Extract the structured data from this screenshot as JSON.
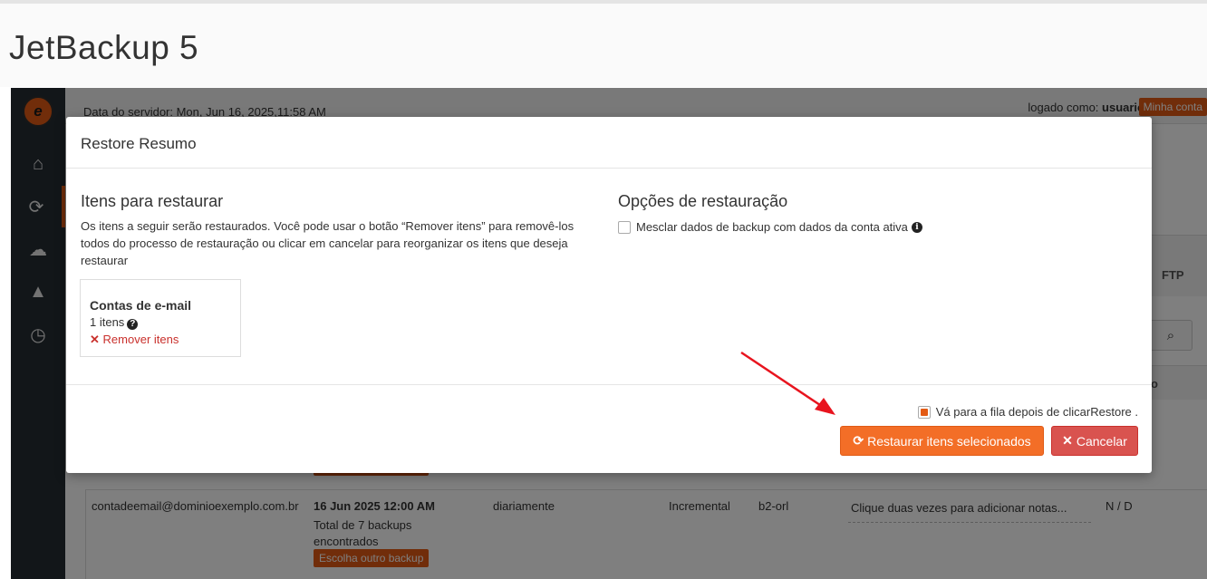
{
  "app": {
    "title": "JetBackup 5"
  },
  "header": {
    "server_date": "Data do servidor: Mon, Jun 16, 2025,11:58 AM",
    "logged_as_prefix": "logado como: ",
    "username": "usuario",
    "separator": " |",
    "my_account": "Minha conta"
  },
  "sidebar": {
    "items": [
      {
        "name": "home-icon",
        "glyph": "⌂"
      },
      {
        "name": "restore-icon",
        "glyph": "⟳"
      },
      {
        "name": "cloud-download-icon",
        "glyph": "☁"
      },
      {
        "name": "warning-icon",
        "glyph": "▲"
      },
      {
        "name": "clock-icon",
        "glyph": "◷"
      }
    ]
  },
  "background": {
    "ftp_header": "FTP",
    "col_header": "o",
    "row": {
      "email": "contadeemail@dominioexemplo.com.br",
      "date": "16 Jun 2025 12:00 AM",
      "total": "Total de 7 backups encontrados",
      "choose_other": "Escolha outro backup",
      "frequency": "diariamente",
      "type": "Incremental",
      "destination": "b2-orl",
      "notes": "Clique duas vezes para adicionar notas...",
      "nd": "N / D"
    }
  },
  "modal": {
    "title": "Restore Resumo",
    "items_title": "Itens para restaurar",
    "items_desc": "Os itens a seguir serão restaurados. Você pode usar o botão “Remover itens” para removê-los todos do processo de restauração ou clicar em cancelar para reorganizar os itens que deseja restaurar",
    "card": {
      "title": "Contas de e-mail",
      "count": "1 itens",
      "remove": "Remover itens"
    },
    "options_title": "Opções de restauração",
    "merge_label": "Mesclar dados de backup com dados da conta ativa",
    "merge_checked": false,
    "queue_label": "Vá para a fila depois de clicarRestore .",
    "queue_checked": true,
    "restore_button": "Restaurar itens selecionados",
    "cancel_button": "Cancelar"
  },
  "colors": {
    "accent": "#e35a14",
    "restore_button": "#f36e27",
    "cancel_button": "#d9534f",
    "sidebar": "#252d33",
    "arrow": "#e8141e"
  }
}
